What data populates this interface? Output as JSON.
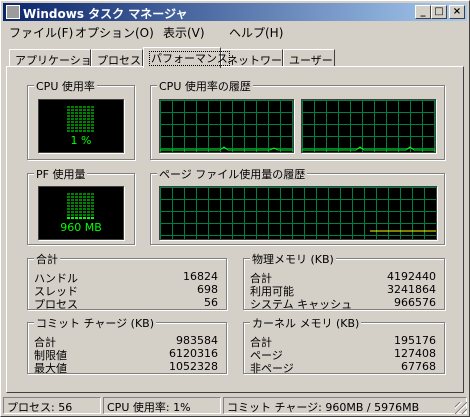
{
  "window": {
    "title": "Windows タスク マネージャ",
    "minimize_glyph": "_",
    "maximize_glyph": "□",
    "close_glyph": "×"
  },
  "menu": [
    "ファイル(F)",
    "オプション(O)",
    "表示(V)",
    "ヘルプ(H)"
  ],
  "tabs": [
    {
      "label": "アプリケーション",
      "active": false
    },
    {
      "label": "プロセス",
      "active": false
    },
    {
      "label": "パフォーマンス",
      "active": true
    },
    {
      "label": "ネットワーク",
      "active": false
    },
    {
      "label": "ユーザー",
      "active": false
    }
  ],
  "cpu_usage": {
    "title": "CPU 使用率",
    "value": "1 %",
    "level_percent": 1
  },
  "cpu_history": {
    "title": "CPU 使用率の履歴"
  },
  "pf_usage": {
    "title": "PF 使用量",
    "value": "960 MB",
    "level_percent": 16
  },
  "pf_history": {
    "title": "ページ ファイル使用量の履歴"
  },
  "totals": {
    "title": "合計",
    "rows": [
      {
        "label": "ハンドル",
        "value": "16824"
      },
      {
        "label": "スレッド",
        "value": "698"
      },
      {
        "label": "プロセス",
        "value": "56"
      }
    ]
  },
  "physical_memory": {
    "title": "物理メモリ (KB)",
    "rows": [
      {
        "label": "合計",
        "value": "4192440"
      },
      {
        "label": "利用可能",
        "value": "3241864"
      },
      {
        "label": "システム キャッシュ",
        "value": "966576"
      }
    ]
  },
  "commit_charge": {
    "title": "コミット チャージ (KB)",
    "rows": [
      {
        "label": "合計",
        "value": "983584"
      },
      {
        "label": "制限値",
        "value": "6120316"
      },
      {
        "label": "最大値",
        "value": "1052328"
      }
    ]
  },
  "kernel_memory": {
    "title": "カーネル メモリ (KB)",
    "rows": [
      {
        "label": "合計",
        "value": "195176"
      },
      {
        "label": "ページ",
        "value": "127408"
      },
      {
        "label": "非ページ",
        "value": "67768"
      }
    ]
  },
  "statusbar": {
    "processes": "プロセス: 56",
    "cpu": "CPU 使用率: 1%",
    "commit": "コミット チャージ: 960MB / 5976MB"
  },
  "colors": {
    "graph_line": "#00ff00",
    "graph_grid": "#008040",
    "pf_line": "#ffff00",
    "titlebar": "#0a246a"
  }
}
